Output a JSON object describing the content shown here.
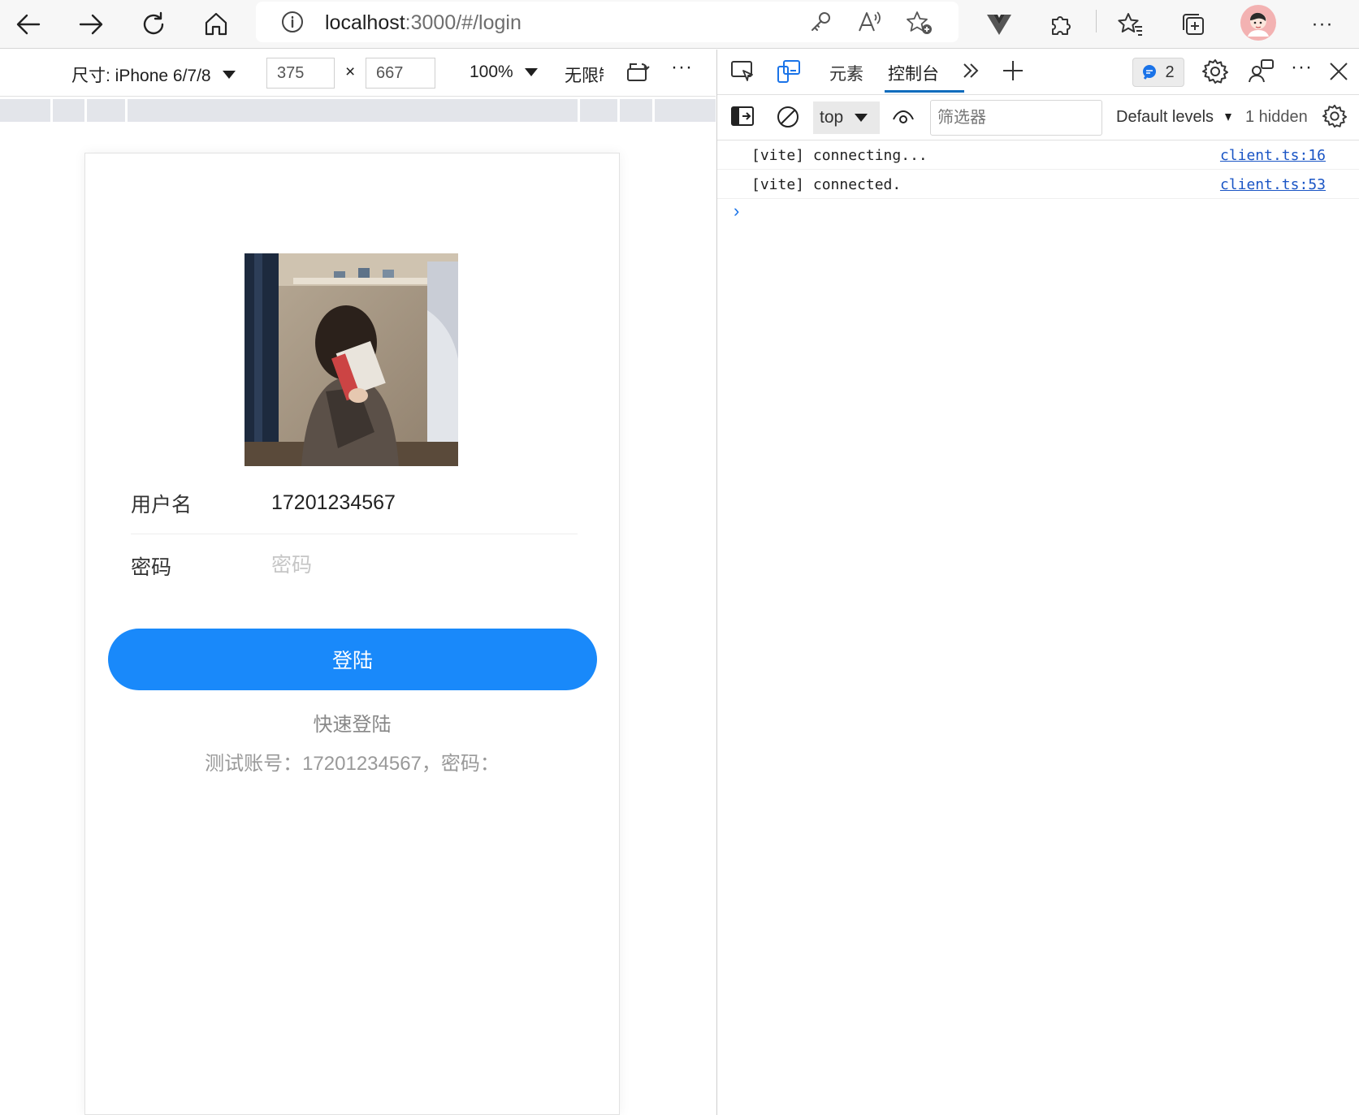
{
  "browser": {
    "url_host": "localhost",
    "url_path": ":3000/#/login",
    "more_label": "···"
  },
  "device_toolbar": {
    "device_label": "尺寸: iPhone 6/7/8",
    "width_value": "375",
    "height_value": "667",
    "times": "×",
    "zoom_label": "100%",
    "throttle_label": "无限制",
    "more_label": "···"
  },
  "login": {
    "username_label": "用户名",
    "username_value": "17201234567",
    "password_label": "密码",
    "password_placeholder": "密码",
    "login_button": "登陆",
    "quick_login": "快速登陆",
    "test_account": "测试账号：17201234567，密码："
  },
  "devtools": {
    "tabs": [
      {
        "label": "元素"
      },
      {
        "label": "控制台"
      }
    ],
    "issues_count": "2",
    "more_label": "···",
    "context_label": "top",
    "filter_placeholder": "筛选器",
    "levels_label": "Default levels",
    "hidden_label": "1 hidden",
    "messages": [
      {
        "text": "[vite] connecting...",
        "source": "client.ts:16"
      },
      {
        "text": "[vite] connected.",
        "source": "client.ts:53"
      }
    ],
    "prompt": "›"
  },
  "colors": {
    "accent": "#1989fa",
    "devtools_active": "#0f6cbd",
    "link": "#1a55c5"
  }
}
